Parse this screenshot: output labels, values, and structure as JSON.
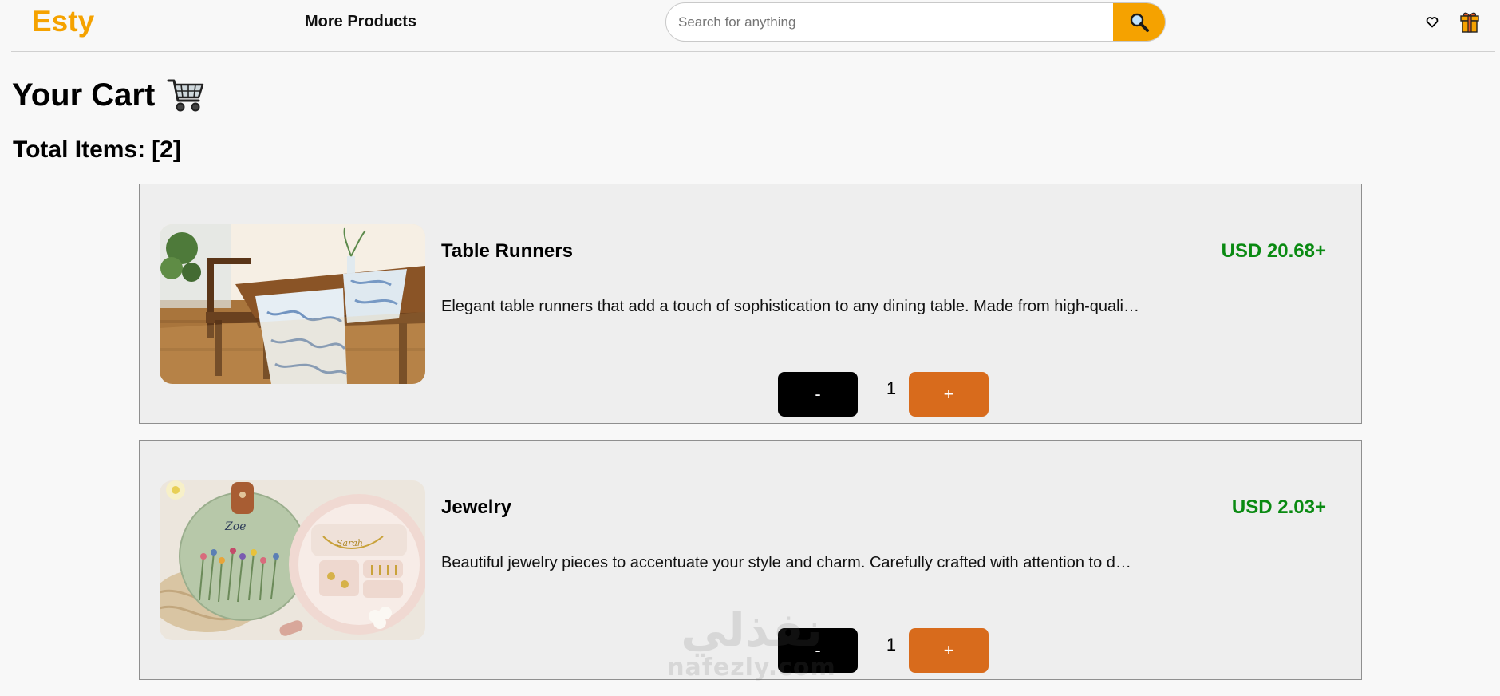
{
  "header": {
    "logo": "Esty",
    "nav_link": "More Products",
    "search_placeholder": "Search for anything",
    "search_icon": "magnifier-icon",
    "wishlist_icon": "heart-icon",
    "gift_icon": "gift-icon"
  },
  "page": {
    "title": "Your Cart",
    "title_icon": "shopping-cart-icon",
    "total_label": "Total Items:",
    "total_count": "[2]"
  },
  "cart_items": [
    {
      "name": "Table Runners",
      "price": "USD 20.68+",
      "description": "Elegant table runners that add a touch of sophistication to any dining table. Made from high-quali…",
      "quantity": "1",
      "minus_label": "-",
      "plus_label": "+"
    },
    {
      "name": "Jewelry",
      "price": "USD 2.03+",
      "description": "Beautiful jewelry pieces to accentuate your style and charm. Carefully crafted with attention to d…",
      "quantity": "1",
      "minus_label": "-",
      "plus_label": "+"
    }
  ],
  "watermark": {
    "arabic": "نفذلي",
    "latin": "nafezly.com"
  },
  "colors": {
    "brand": "#f5a200",
    "price": "#0a8a12",
    "plus_button": "#d86b1c",
    "minus_button": "#000000",
    "card_background": "#eeeeee"
  }
}
